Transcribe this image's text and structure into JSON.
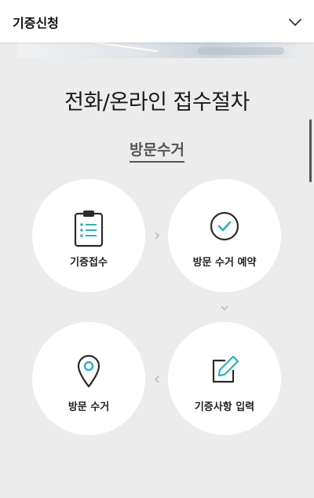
{
  "header": {
    "title": "기증신청",
    "toggle_icon": "chevron-down-icon"
  },
  "page": {
    "title": "전화/온라인 접수절차"
  },
  "section": {
    "title": "방문수거"
  },
  "steps": [
    {
      "label": "기증접수",
      "icon": "clipboard-list-icon"
    },
    {
      "label": "방문 수거 예약",
      "icon": "check-circle-icon"
    },
    {
      "label": "방문 수거",
      "icon": "location-pin-icon"
    },
    {
      "label": "기증사항 입력",
      "icon": "edit-icon"
    }
  ],
  "colors": {
    "accent": "#2bb3c0",
    "dark": "#2b2b2b",
    "background": "#ececec"
  }
}
